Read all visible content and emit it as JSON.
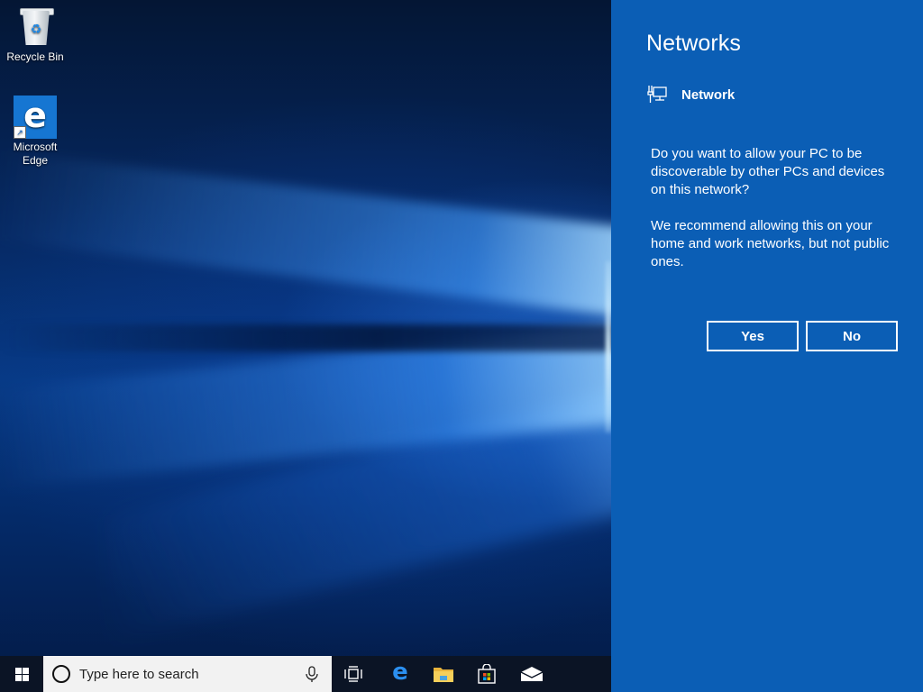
{
  "desktop": {
    "icons": [
      {
        "label": "Recycle Bin",
        "icon": "recycle-bin-icon"
      },
      {
        "label": "Microsoft Edge",
        "icon": "edge-icon"
      }
    ]
  },
  "flyout": {
    "title": "Networks",
    "network_name": "Network",
    "network_icon": "wired-network-icon",
    "question": "Do you want to allow your PC to be discoverable by other PCs and devices on this network?",
    "recommendation": "We recommend allowing this on your home and work networks, but not public ones.",
    "yes_label": "Yes",
    "no_label": "No",
    "background_color": "#0b5eb5"
  },
  "taskbar": {
    "search_placeholder": "Type here to search",
    "items": [
      {
        "name": "start",
        "icon": "windows-logo-icon"
      },
      {
        "name": "task-view",
        "icon": "task-view-icon"
      },
      {
        "name": "edge",
        "icon": "edge-icon"
      },
      {
        "name": "file-explorer",
        "icon": "folder-icon"
      },
      {
        "name": "store",
        "icon": "store-bag-icon"
      },
      {
        "name": "mail",
        "icon": "mail-envelope-icon"
      }
    ]
  }
}
